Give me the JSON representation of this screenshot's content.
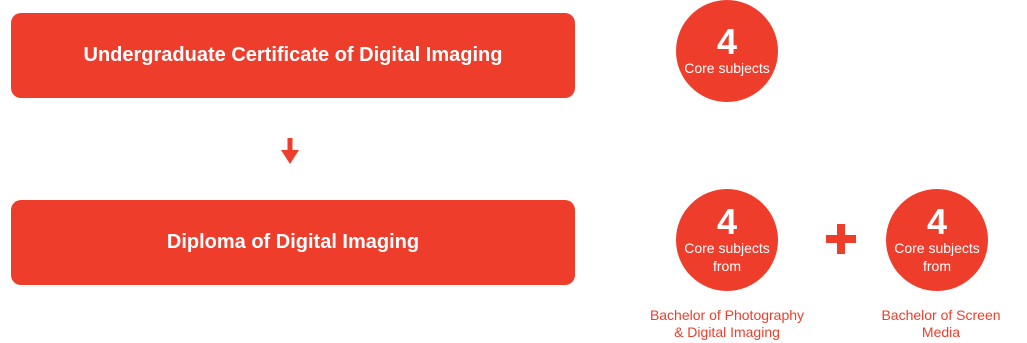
{
  "boxes": {
    "certificate": "Undergraduate Certificate of Digital Imaging",
    "diploma": "Diploma of Digital Imaging"
  },
  "circles": {
    "core": {
      "number": "4",
      "label": "Core subjects"
    },
    "photography": {
      "number": "4",
      "label": "Core subjects",
      "suffix": "from"
    },
    "screen": {
      "number": "4",
      "label": "Core subjects",
      "suffix": "from"
    }
  },
  "captions": {
    "photography_line1": "Bachelor of Photography",
    "photography_line2": "& Digital Imaging",
    "screen_line1": "Bachelor of Screen",
    "screen_line2": "Media"
  },
  "icons": {
    "arrow": "arrow-down-icon",
    "plus": "plus-icon"
  },
  "colors": {
    "accent": "#ef3d2c",
    "text_on_accent": "#ffffff"
  }
}
